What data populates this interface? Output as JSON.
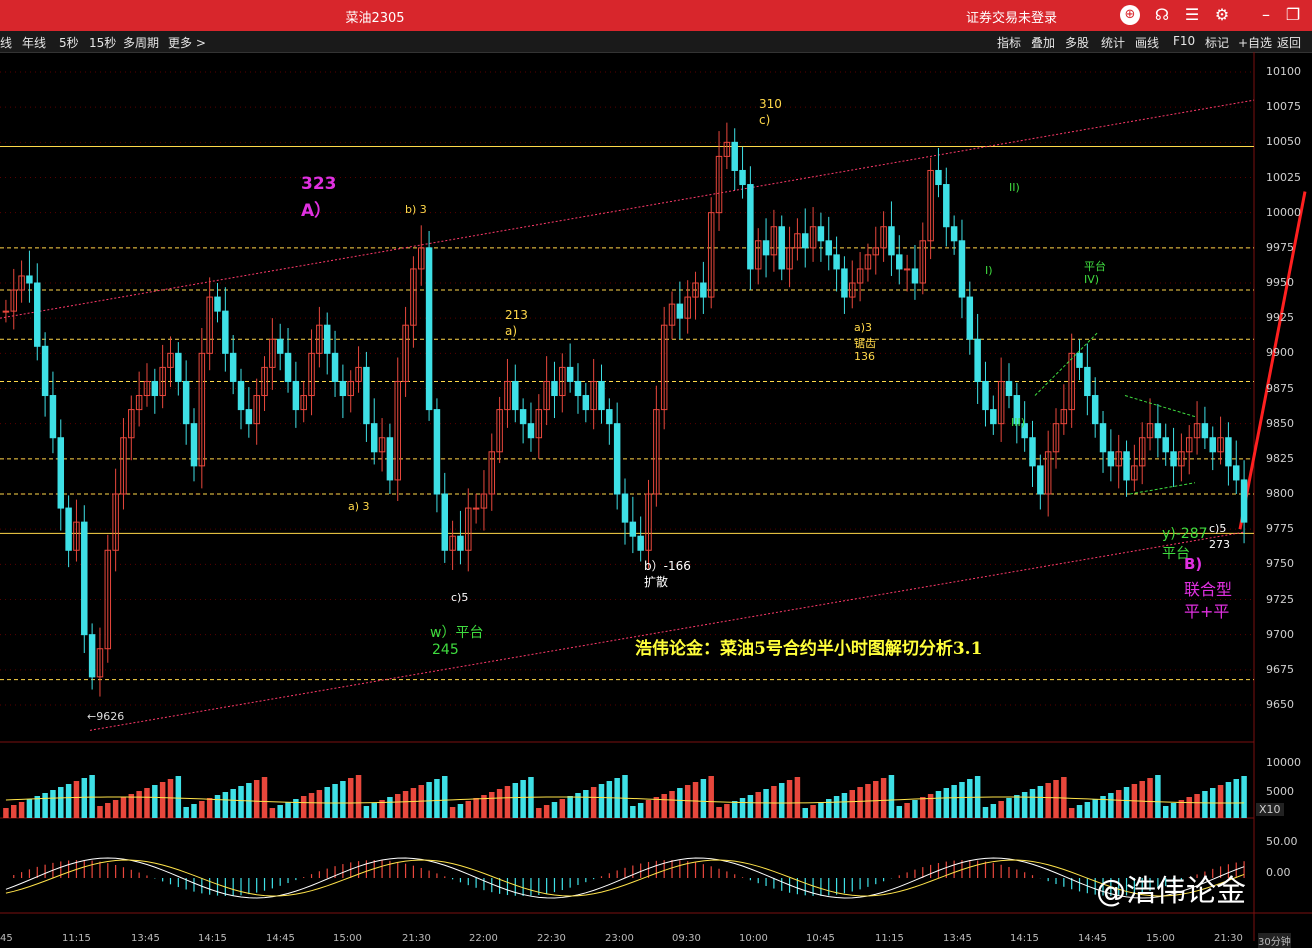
{
  "window": {
    "title": "菜油2305",
    "login_status": "证券交易未登录"
  },
  "toolbar_left": [
    "线",
    "年线",
    "5秒",
    "15秒",
    "多周期",
    "更多 >"
  ],
  "toolbar_right": [
    "指标",
    "叠加",
    "多股",
    "统计",
    "画线",
    "F10",
    "标记",
    "+自选",
    "返回"
  ],
  "price_axis": [
    "10100",
    "10075",
    "10050",
    "10025",
    "10000",
    "9975",
    "9950",
    "9925",
    "9900",
    "9875",
    "9850",
    "9825",
    "9800",
    "9775",
    "9750",
    "9725",
    "9700",
    "9675",
    "9650"
  ],
  "volume_axis": [
    "10000",
    "5000",
    "X10"
  ],
  "macd_axis": [
    "50.00",
    "0.00"
  ],
  "time_axis": [
    "45",
    "11:15",
    "13:45",
    "14:15",
    "14:45",
    "15:00",
    "21:30",
    "22:00",
    "22:30",
    "23:00",
    "09:30",
    "10:00",
    "10:45",
    "11:15",
    "13:45",
    "14:15",
    "14:45",
    "15:00",
    "21:30",
    "30分钟"
  ],
  "annotations": {
    "a_wave_num": "323",
    "a_wave": "A）",
    "b3_top": "b) 3",
    "a3_low": "a) 3",
    "n213": "213",
    "a_paren": "a)",
    "n310": "310",
    "c_paren": "c)",
    "c5_left": "c)5",
    "w_platform": "w）平台",
    "n245": "245",
    "b_neg": "b）-166",
    "kuosan": "扩散",
    "a3_mid": "a)3",
    "juchi": "锯齿",
    "n136": "136",
    "ii": "II)",
    "i": "I)",
    "iii": "III)",
    "pingtai": "平台",
    "iv": "IV)",
    "y_neg": "y)-287",
    "pingtai2": "平台",
    "c5_right": "c)5",
    "n273": "273",
    "b_paren": "B)",
    "lianhe": "联合型",
    "pingping": "平+平",
    "low_price": "←9626"
  },
  "subtitle": "浩伟论金：菜油5号合约半小时图解切分析3.1",
  "watermark": "@浩伟论金",
  "colors": {
    "titlebar": "#d8262c",
    "up": "#e8473c",
    "down": "#3ee0e6",
    "yellow": "#ffd84a",
    "magenta": "#e030e0",
    "green": "#3fdc3f"
  },
  "chart_data": {
    "type": "candlestick",
    "title": "",
    "ylim": [
      9630,
      10105
    ],
    "grid": true,
    "horizontal_levels": [
      10047,
      9975,
      9945,
      9910,
      9880,
      9825,
      9800,
      9772,
      9668
    ],
    "closes": [
      9930,
      9945,
      9955,
      9950,
      9905,
      9870,
      9840,
      9790,
      9760,
      9780,
      9700,
      9670,
      9690,
      9760,
      9800,
      9840,
      9860,
      9870,
      9880,
      9870,
      9890,
      9900,
      9880,
      9850,
      9820,
      9900,
      9940,
      9930,
      9900,
      9880,
      9860,
      9850,
      9870,
      9890,
      9910,
      9900,
      9880,
      9860,
      9870,
      9900,
      9920,
      9900,
      9880,
      9870,
      9880,
      9890,
      9850,
      9830,
      9840,
      9810,
      9880,
      9920,
      9960,
      9975,
      9860,
      9800,
      9760,
      9770,
      9760,
      9790,
      9790,
      9800,
      9830,
      9860,
      9880,
      9860,
      9850,
      9840,
      9860,
      9880,
      9870,
      9890,
      9880,
      9870,
      9860,
      9880,
      9860,
      9850,
      9800,
      9780,
      9770,
      9760,
      9800,
      9860,
      9920,
      9935,
      9925,
      9940,
      9950,
      9940,
      10000,
      10040,
      10050,
      10030,
      10020,
      9960,
      9980,
      9970,
      9990,
      9960,
      9975,
      9985,
      9975,
      9990,
      9980,
      9970,
      9960,
      9940,
      9950,
      9960,
      9970,
      9975,
      9990,
      9970,
      9960,
      9960,
      9950,
      9980,
      10030,
      10020,
      9990,
      9980,
      9940,
      9910,
      9880,
      9860,
      9850,
      9880,
      9870,
      9850,
      9840,
      9820,
      9800,
      9830,
      9850,
      9860,
      9900,
      9890,
      9870,
      9850,
      9830,
      9820,
      9830,
      9810,
      9820,
      9840,
      9850,
      9840,
      9830,
      9820,
      9830,
      9840,
      9850,
      9840,
      9830,
      9840,
      9820,
      9810,
      9780
    ]
  }
}
